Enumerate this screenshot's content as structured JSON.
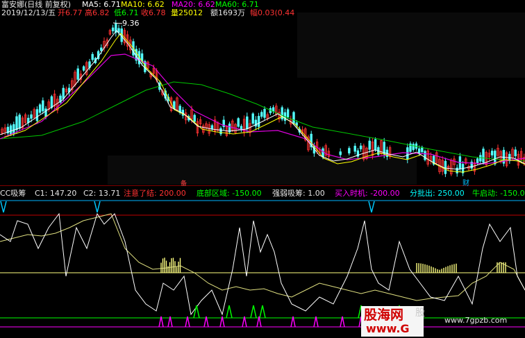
{
  "header": {
    "stock_name": "富安娜(日线 前复权)",
    "ma5": "MA5: 6.71",
    "ma10": "MA10: 6.62",
    "ma20": "MA20: 6.62",
    "ma60": "MA60: 6.71",
    "date": "2019/12/13/五",
    "open": "开6.77",
    "high": "高6.82",
    "low": "低6.71",
    "close": "收6.78",
    "volume": "量25012",
    "amount": "额1693万",
    "change": "幅0.03(0.44"
  },
  "price_panel": {
    "peak_label": "9.36",
    "marker_cai": "财",
    "marker_top": "备"
  },
  "indicator_header": {
    "name": "CC吸筹",
    "c1": "C1: 147.20",
    "c2": "C2: 13.71",
    "zhuyi": "注意了结: 200.00",
    "dibu": "底部区域: -150.00",
    "qiangruo": "强弱吸筹: 1.00",
    "mairu": "买入时机: -200.00",
    "fenpi": "分批出: 250.00",
    "niu": "牛启动: -150.0"
  },
  "watermark": {
    "brand": "股海网",
    "site_left": "www.G",
    "site_right": "www.7gpzb.com",
    "partial": "股"
  },
  "colors": {
    "ma5": "#ffffff",
    "ma10": "#ffff00",
    "ma20": "#ff00ff",
    "ma60": "#00ff00",
    "up": "#ff3232",
    "down": "#54ffff",
    "accent_cyan": "#00ffff"
  }
}
